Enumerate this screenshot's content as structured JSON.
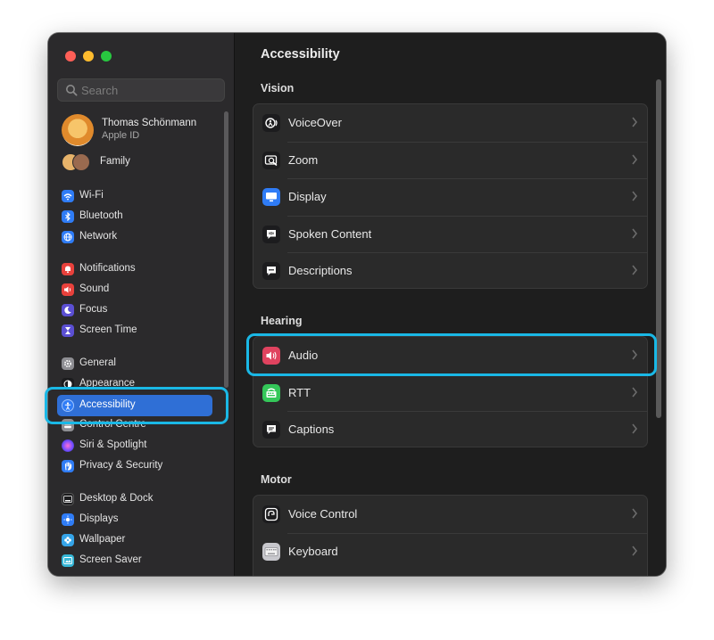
{
  "search": {
    "placeholder": "Search"
  },
  "profile": {
    "name": "Thomas Schönmann",
    "subtitle": "Apple ID"
  },
  "family": {
    "label": "Family"
  },
  "sidebar": {
    "items": [
      {
        "label": "Wi-Fi",
        "icon": "wifi-icon",
        "color": "#2f7cf6"
      },
      {
        "label": "Bluetooth",
        "icon": "bluetooth-icon",
        "color": "#2f7cf6"
      },
      {
        "label": "Network",
        "icon": "globe-icon",
        "color": "#2f7cf6"
      },
      {
        "label": "Notifications",
        "icon": "bell-icon",
        "color": "#e8413c"
      },
      {
        "label": "Sound",
        "icon": "speaker-icon",
        "color": "#e8413c"
      },
      {
        "label": "Focus",
        "icon": "moon-icon",
        "color": "#5b4fd3"
      },
      {
        "label": "Screen Time",
        "icon": "hourglass-icon",
        "color": "#5b4fd3"
      },
      {
        "label": "General",
        "icon": "gear-icon",
        "color": "#8e8e93"
      },
      {
        "label": "Appearance",
        "icon": "appearance-icon",
        "color": "#1c1c1e"
      },
      {
        "label": "Accessibility",
        "icon": "accessibility-icon",
        "color": "#2f7cf6"
      },
      {
        "label": "Control Centre",
        "icon": "switches-icon",
        "color": "#8e8e93"
      },
      {
        "label": "Siri & Spotlight",
        "icon": "siri-icon",
        "color": "#a24be0"
      },
      {
        "label": "Privacy & Security",
        "icon": "hand-icon",
        "color": "#2f7cf6"
      },
      {
        "label": "Desktop & Dock",
        "icon": "dock-icon",
        "color": "#1c1c1e"
      },
      {
        "label": "Displays",
        "icon": "sun-icon",
        "color": "#2f7cf6"
      },
      {
        "label": "Wallpaper",
        "icon": "flower-icon",
        "color": "#35a4e8"
      },
      {
        "label": "Screen Saver",
        "icon": "screensaver-icon",
        "color": "#35b6d6"
      }
    ]
  },
  "main": {
    "title": "Accessibility",
    "sections": [
      {
        "title": "Vision",
        "rows": [
          {
            "label": "VoiceOver",
            "icon": "voiceover-icon",
            "color": "#1c1c1e"
          },
          {
            "label": "Zoom",
            "icon": "zoom-icon",
            "color": "#1c1c1e"
          },
          {
            "label": "Display",
            "icon": "display-icon",
            "color": "#2f7cf6"
          },
          {
            "label": "Spoken Content",
            "icon": "speech-bubble-icon",
            "color": "#1c1c1e"
          },
          {
            "label": "Descriptions",
            "icon": "description-bubble-icon",
            "color": "#1c1c1e"
          }
        ]
      },
      {
        "title": "Hearing",
        "rows": [
          {
            "label": "Audio",
            "icon": "audio-icon",
            "color": "#e0435f"
          },
          {
            "label": "RTT",
            "icon": "rtt-icon",
            "color": "#34c759"
          },
          {
            "label": "Captions",
            "icon": "captions-icon",
            "color": "#1c1c1e"
          }
        ]
      },
      {
        "title": "Motor",
        "rows": [
          {
            "label": "Voice Control",
            "icon": "voice-control-icon",
            "color": "#1c1c1e"
          },
          {
            "label": "Keyboard",
            "icon": "keyboard-icon",
            "color": "#c7c7cc"
          }
        ]
      }
    ]
  },
  "highlight_color": "#1ab8e6"
}
